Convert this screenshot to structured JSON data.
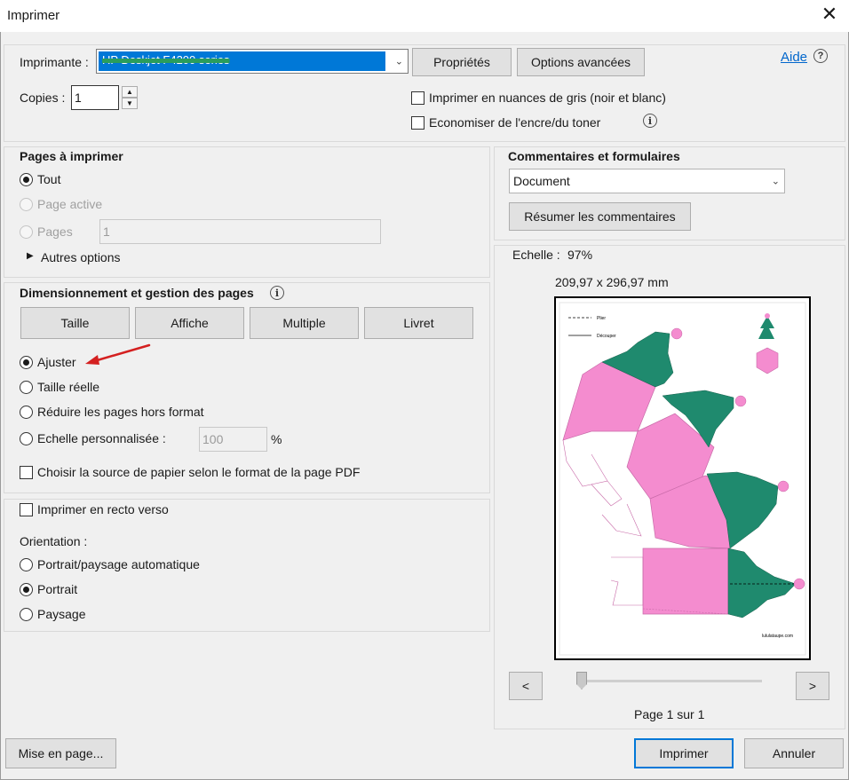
{
  "window": {
    "title": "Imprimer",
    "close_glyph": "✕"
  },
  "printer": {
    "label": "Imprimante :",
    "selected": "HP Deskjet F4200 series",
    "properties_btn": "Propriétés",
    "advanced_btn": "Options avancées",
    "help_link": "Aide",
    "help_icon": "?",
    "copies_label": "Copies :",
    "copies_value": "1",
    "grayscale_label": "Imprimer en nuances de gris (noir et blanc)",
    "save_ink_label": "Economiser de l'encre/du toner"
  },
  "pages": {
    "heading": "Pages à imprimer",
    "all": "Tout",
    "current": "Page active",
    "pages": "Pages",
    "pages_value": "1",
    "more": "Autres options"
  },
  "sizing": {
    "heading": "Dimensionnement et gestion des pages",
    "tabs": [
      "Taille",
      "Affiche",
      "Multiple",
      "Livret"
    ],
    "fit": "Ajuster",
    "actual": "Taille réelle",
    "shrink": "Réduire les pages hors format",
    "custom": "Echelle personnalisée :",
    "custom_value": "100",
    "percent": "%",
    "paper_source": "Choisir la source de papier selon le format de la page PDF"
  },
  "duplex": {
    "label": "Imprimer en recto verso",
    "orientation_label": "Orientation :",
    "auto": "Portrait/paysage automatique",
    "portrait": "Portrait",
    "landscape": "Paysage"
  },
  "comments": {
    "heading": "Commentaires et formulaires",
    "selected": "Document",
    "summarize_btn": "Résumer les commentaires"
  },
  "preview": {
    "scale_label": "Echelle :",
    "scale_value": "97%",
    "dimensions": "209,97 x 296,97 mm",
    "legend_fold": "Plier",
    "legend_cut": "Découper",
    "credit": "lululataupe.com",
    "prev": "<",
    "next": ">",
    "page_info": "Page 1 sur 1"
  },
  "footer": {
    "page_setup_btn": "Mise en page...",
    "print_btn": "Imprimer",
    "cancel_btn": "Annuler"
  },
  "colors": {
    "selection_blue": "#0078d7",
    "annotation_red": "#d42020",
    "tree_green": "#1f8a6e",
    "box_pink": "#f48ccf"
  }
}
